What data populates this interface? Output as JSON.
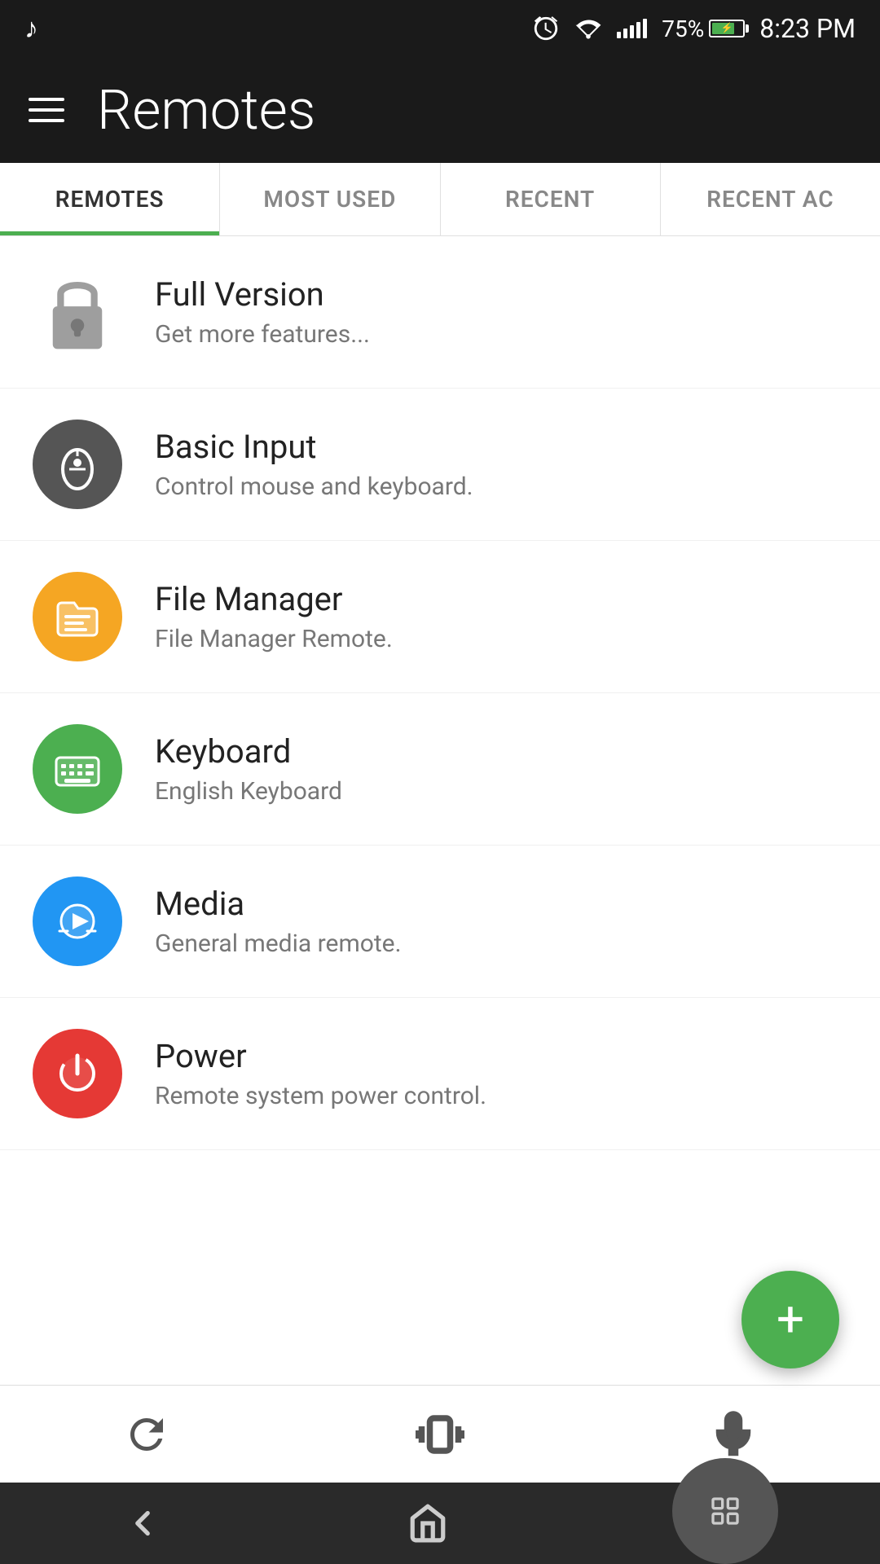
{
  "statusBar": {
    "time": "8:23 PM",
    "battery": "75%",
    "charging": true
  },
  "header": {
    "title": "Remotes",
    "menu_label": "Menu"
  },
  "tabs": [
    {
      "id": "remotes",
      "label": "REMOTES",
      "active": true
    },
    {
      "id": "most-used",
      "label": "MOST USED",
      "active": false
    },
    {
      "id": "recent",
      "label": "RECENT",
      "active": false
    },
    {
      "id": "recent-ac",
      "label": "RECENT AC",
      "active": false
    }
  ],
  "remotes": [
    {
      "id": "full-version",
      "name": "Full Version",
      "desc": "Get more features...",
      "iconType": "lock",
      "iconColor": "#9e9e9e"
    },
    {
      "id": "basic-input",
      "name": "Basic Input",
      "desc": "Control mouse and keyboard.",
      "iconType": "mouse",
      "iconColor": "#555555"
    },
    {
      "id": "file-manager",
      "name": "File Manager",
      "desc": "File Manager Remote.",
      "iconType": "folder",
      "iconColor": "#f5a623"
    },
    {
      "id": "keyboard",
      "name": "Keyboard",
      "desc": "English Keyboard",
      "iconType": "keyboard",
      "iconColor": "#4caf50"
    },
    {
      "id": "media",
      "name": "Media",
      "desc": "General media remote.",
      "iconType": "play",
      "iconColor": "#2196f3"
    },
    {
      "id": "power",
      "name": "Power",
      "desc": "Remote system power control.",
      "iconType": "power",
      "iconColor": "#e53935"
    }
  ],
  "fab": {
    "label": "+"
  },
  "actionBar": {
    "refresh_label": "Refresh",
    "vibrate_label": "Vibrate",
    "mic_label": "Microphone"
  },
  "navBar": {
    "back_label": "Back",
    "home_label": "Home",
    "recents_label": "Recents"
  }
}
